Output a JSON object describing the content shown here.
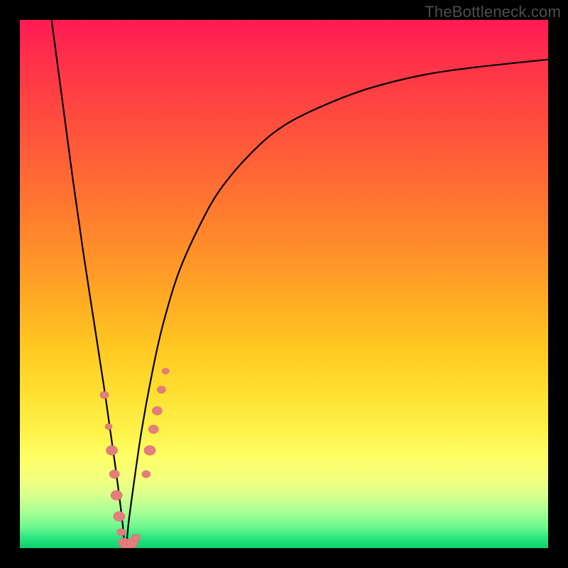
{
  "watermark": "TheBottleneck.com",
  "colors": {
    "curve_stroke": "#000000",
    "marker_fill": "#e47d7d",
    "marker_stroke": "#d86b6b"
  },
  "chart_data": {
    "type": "line",
    "title": "",
    "xlabel": "",
    "ylabel": "",
    "xlim": [
      0,
      100
    ],
    "ylim": [
      0,
      100
    ],
    "grid": false,
    "note": "V-shaped bottleneck curve; minimum near x≈20; x and y plotted as 0–100%.",
    "series": [
      {
        "name": "bottleneck-curve",
        "x": [
          6,
          8,
          10,
          12,
          14,
          16,
          17,
          18,
          18.8,
          19.4,
          20,
          20.6,
          21.4,
          23,
          25,
          27,
          30,
          34,
          38,
          44,
          50,
          58,
          66,
          76,
          86,
          100
        ],
        "y": [
          100,
          85,
          70,
          56,
          43,
          30,
          23,
          16,
          10,
          5,
          0,
          5,
          11,
          22,
          33,
          42,
          52,
          61,
          68,
          75,
          80,
          84,
          87,
          89.5,
          91,
          92.5
        ]
      }
    ],
    "markers": {
      "name": "highlight-points",
      "points": [
        {
          "x": 16.0,
          "y": 29.0,
          "r": 6
        },
        {
          "x": 16.8,
          "y": 23.0,
          "r": 5
        },
        {
          "x": 17.4,
          "y": 18.5,
          "r": 8
        },
        {
          "x": 17.9,
          "y": 14.0,
          "r": 7
        },
        {
          "x": 18.3,
          "y": 10.0,
          "r": 8
        },
        {
          "x": 18.8,
          "y": 6.0,
          "r": 8
        },
        {
          "x": 19.2,
          "y": 3.0,
          "r": 6
        },
        {
          "x": 19.7,
          "y": 1.0,
          "r": 8
        },
        {
          "x": 20.5,
          "y": 0.5,
          "r": 9
        },
        {
          "x": 21.3,
          "y": 1.0,
          "r": 8
        },
        {
          "x": 22.0,
          "y": 2.0,
          "r": 6
        },
        {
          "x": 23.9,
          "y": 14.0,
          "r": 6
        },
        {
          "x": 24.6,
          "y": 18.5,
          "r": 8
        },
        {
          "x": 25.3,
          "y": 22.5,
          "r": 7
        },
        {
          "x": 26.0,
          "y": 26.0,
          "r": 7
        },
        {
          "x": 26.8,
          "y": 30.0,
          "r": 6
        },
        {
          "x": 27.6,
          "y": 33.5,
          "r": 5
        }
      ]
    }
  }
}
